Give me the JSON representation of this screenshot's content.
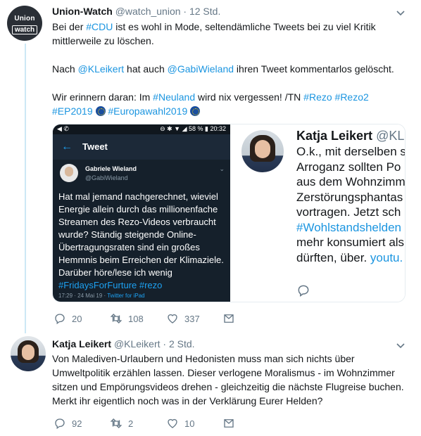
{
  "tweet1": {
    "name": "Union-Watch",
    "handle": "@watch_union",
    "time": "· 12 Std.",
    "avatar_text_1": "Union",
    "avatar_text_2": "watch",
    "line1_a": "Bei der ",
    "line1_link": "#CDU",
    "line1_b": " ist es wohl in Mode, seltendämliche Tweets bei zu viel Kritik",
    "line2": "mittlerweile zu löschen.",
    "line3_a": "Nach ",
    "line3_link1": "@KLeikert",
    "line3_b": " hat auch ",
    "line3_link2": "@GabiWieland",
    "line3_c": " ihren Tweet kommentarlos gelöscht.",
    "line4_a": "Wir erinnern daran: Im ",
    "line4_link1": "#Neuland",
    "line4_b": " wird nix vergessen! /TN ",
    "line4_link2": "#Rezo",
    "line4_link3": "#Rezo2",
    "line5_link1": "#EP2019",
    "line5_link2": "#Europawahl2019",
    "replies": "20",
    "retweets": "108",
    "likes": "337"
  },
  "screenshot": {
    "status_left": "◀ ✆",
    "status_right": "⊖ ✱ ▼ ◢ 58 % ▮ 20:32",
    "nav_title": "Tweet",
    "author": "Gabriele Wieland",
    "handle": "@GabiWieland",
    "text_main": "Hat mal jemand nachgerechnet, wieviel Energie allein durch das millionenfache Streamen des Rezo-Videos verbraucht wurde? Ständig steigende Online-Übertragungsraten sind ein großes Hemmnis beim Erreichen der Klimaziele. Darüber höre/lese ich wenig ",
    "text_link1": "#FridaysForFurture",
    "text_link2": "#rezo",
    "footer": "17:29 · 24 Mai 19 · ",
    "footer_link": "Twitter for iPad"
  },
  "quoted": {
    "name": "Katja Leikert",
    "handle": "@KLeik",
    "l1": "O.k., mit derselben s",
    "l2": "Arroganz sollten Po",
    "l3": "aus dem Wohnzimm",
    "l4": "Zerstörungsphantas",
    "l5": "vortragen. Jetzt sch",
    "l6_link": "#Wohlstandshelden",
    "l7": "mehr konsumiert als",
    "l8_a": "dürften, über. ",
    "l8_link": "youtu."
  },
  "tweet2": {
    "name": "Katja Leikert",
    "handle": "@KLeikert",
    "time": "· 2 Std.",
    "l1": "Von Malediven-Urlaubern und Hedonisten muss man sich nichts über",
    "l2": "Umweltpolitik erzählen lassen. Dieser verlogene Moralismus - im Wohnzimmer",
    "l3": "sitzen und Empörungsvideos drehen - gleichzeitig die nächste Flugreise buchen.",
    "l4": "Merkt ihr eigentlich noch was in der Verklärung Eurer Helden?",
    "replies": "92",
    "retweets": "2",
    "likes": "10"
  },
  "colors": {
    "link": "#1b95e0",
    "text": "#14171a",
    "muted": "#657786",
    "thread": "#cde8f5"
  },
  "icons": [
    "caret-down-icon",
    "reply-icon",
    "retweet-icon",
    "like-icon",
    "share-icon",
    "back-arrow-icon",
    "eu-flag-emoji"
  ]
}
